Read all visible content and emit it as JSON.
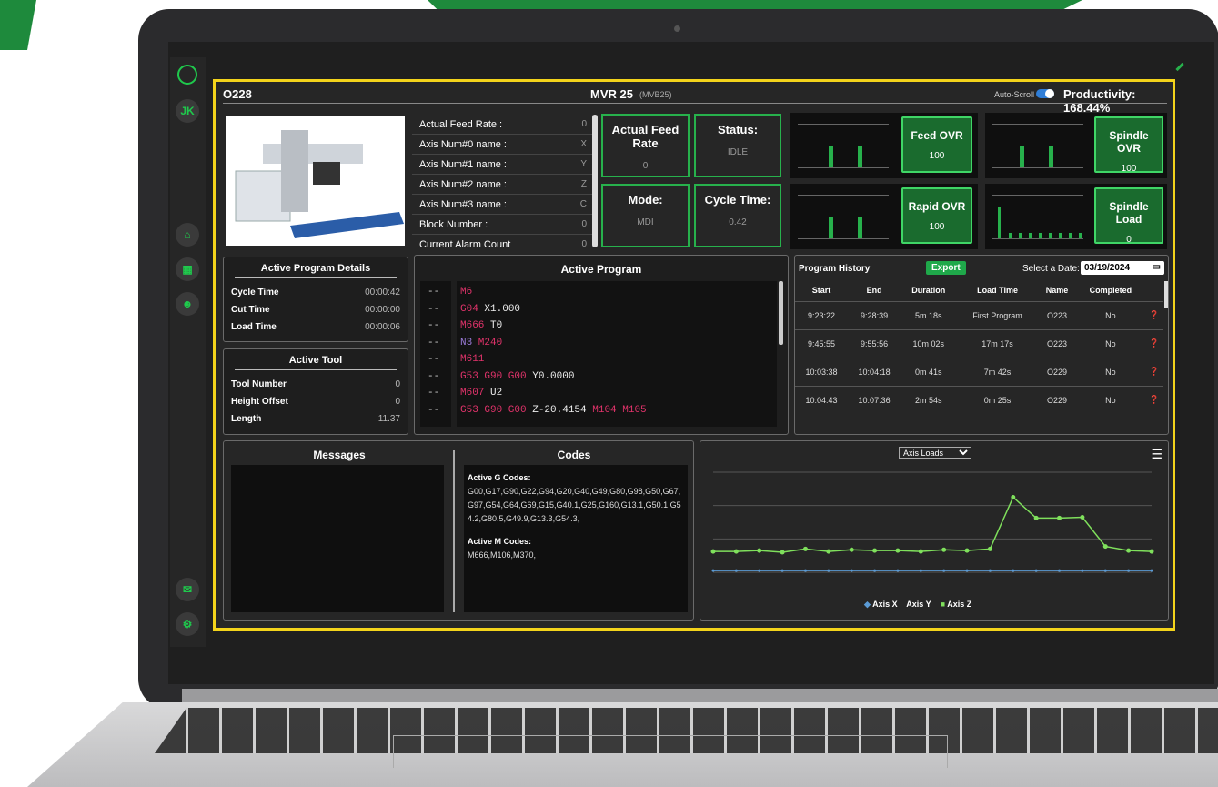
{
  "sidebar": {
    "user": "JK"
  },
  "header": {
    "program": "O228",
    "machine": "MVR 25",
    "machine_sub": "(MVB25)",
    "autoscroll": "Auto-Scroll",
    "productivity": "Productivity: 168.44%"
  },
  "params": [
    {
      "label": "Actual Feed Rate :",
      "value": "0"
    },
    {
      "label": "Axis Num#0 name :",
      "value": "X"
    },
    {
      "label": "Axis Num#1 name :",
      "value": "Y"
    },
    {
      "label": "Axis Num#2 name :",
      "value": "Z"
    },
    {
      "label": "Axis Num#3 name :",
      "value": "C"
    },
    {
      "label": "Block Number :",
      "value": "0"
    },
    {
      "label": "Current Alarm Count",
      "value": "0"
    }
  ],
  "status_cards": {
    "feed_rate": {
      "title": "Actual Feed Rate",
      "value": "0"
    },
    "status": {
      "title": "Status:",
      "value": "IDLE"
    },
    "mode": {
      "title": "Mode:",
      "value": "MDI"
    },
    "cycle": {
      "title": "Cycle Time:",
      "value": "0.42"
    }
  },
  "overrides": {
    "feed": {
      "label": "Feed OVR",
      "value": "100"
    },
    "spindle": {
      "label": "Spindle OVR",
      "value": "100"
    },
    "rapid": {
      "label": "Rapid OVR",
      "value": "100"
    },
    "spindle_load": {
      "label": "Spindle Load",
      "value": "0"
    }
  },
  "program_details": {
    "title": "Active Program Details",
    "rows": [
      {
        "label": "Cycle Time",
        "value": "00:00:42"
      },
      {
        "label": "Cut Time",
        "value": "00:00:00"
      },
      {
        "label": "Load Time",
        "value": "00:00:06"
      }
    ]
  },
  "active_tool": {
    "title": "Active Tool",
    "rows": [
      {
        "label": "Tool Number",
        "value": "0"
      },
      {
        "label": "Height Offset",
        "value": "0"
      },
      {
        "label": "Length",
        "value": "11.37"
      }
    ]
  },
  "active_program": {
    "title": "Active Program",
    "lines": [
      {
        "gutter": "--",
        "parts": [
          {
            "t": "M6",
            "c": "kw"
          }
        ]
      },
      {
        "gutter": "--",
        "parts": [
          {
            "t": "G04",
            "c": "kw"
          },
          {
            "t": " X1.000",
            "c": ""
          }
        ]
      },
      {
        "gutter": "--",
        "parts": [
          {
            "t": "M666",
            "c": "kw"
          },
          {
            "t": " T0",
            "c": ""
          }
        ]
      },
      {
        "gutter": "--",
        "parts": [
          {
            "t": "N3",
            "c": "n"
          },
          {
            "t": " M240",
            "c": "kw"
          }
        ]
      },
      {
        "gutter": "--",
        "parts": [
          {
            "t": "M611",
            "c": "kw"
          }
        ]
      },
      {
        "gutter": "--",
        "parts": [
          {
            "t": "G53 G90 G00",
            "c": "kw"
          },
          {
            "t": " Y0.0000",
            "c": ""
          }
        ]
      },
      {
        "gutter": "--",
        "parts": [
          {
            "t": "M607",
            "c": "kw"
          },
          {
            "t": " U2",
            "c": ""
          }
        ]
      },
      {
        "gutter": "--",
        "parts": [
          {
            "t": "G53 G90 G00",
            "c": "kw"
          },
          {
            "t": " Z-20.4154 ",
            "c": ""
          },
          {
            "t": "M104 M105",
            "c": "kw"
          }
        ]
      }
    ]
  },
  "program_history": {
    "title": "Program History",
    "export": "Export",
    "date_label": "Select a Date:",
    "date_value": "03/19/2024",
    "columns": [
      "Start",
      "End",
      "Duration",
      "Load Time",
      "Name",
      "Completed"
    ],
    "rows": [
      [
        "9:23:22",
        "9:28:39",
        "5m 18s",
        "First Program",
        "O223",
        "No"
      ],
      [
        "9:45:55",
        "9:55:56",
        "10m 02s",
        "17m 17s",
        "O223",
        "No"
      ],
      [
        "10:03:38",
        "10:04:18",
        "0m 41s",
        "7m 42s",
        "O229",
        "No"
      ],
      [
        "10:04:43",
        "10:07:36",
        "2m 54s",
        "0m 25s",
        "O229",
        "No"
      ]
    ]
  },
  "messages": {
    "title": "Messages"
  },
  "codes": {
    "title": "Codes",
    "g_title": "Active G Codes:",
    "g_codes": "G00,G17,G90,G22,G94,G20,G40,G49,G80,G98,G50,G67,G97,G54,G64,G69,G15,G40.1,G25,G160,G13.1,G50.1,G54.2,G80.5,G49.9,G13.3,G54.3,",
    "m_title": "Active M Codes:",
    "m_codes": "M666,M106,M370,"
  },
  "chart": {
    "selector": "Axis Loads",
    "legend": [
      "Axis X",
      "Axis Y",
      "Axis Z"
    ]
  },
  "chart_data": {
    "type": "line",
    "series": [
      {
        "name": "Axis Z",
        "values": [
          2.5,
          2.5,
          2.6,
          2.4,
          2.8,
          2.5,
          2.7,
          2.6,
          2.6,
          2.5,
          2.7,
          2.6,
          2.8,
          9.0,
          6.5,
          6.5,
          6.6,
          3.1,
          2.6,
          2.5
        ]
      },
      {
        "name": "Axis X",
        "values": [
          0.2,
          0.2,
          0.2,
          0.2,
          0.2,
          0.2,
          0.2,
          0.2,
          0.2,
          0.2,
          0.2,
          0.2,
          0.2,
          0.2,
          0.2,
          0.2,
          0.2,
          0.2,
          0.2,
          0.2
        ]
      }
    ],
    "ylim": [
      0,
      12
    ]
  },
  "colors": {
    "accent": "#27b14c",
    "frame": "#f3d31b",
    "code_keyword": "#e2336b"
  }
}
